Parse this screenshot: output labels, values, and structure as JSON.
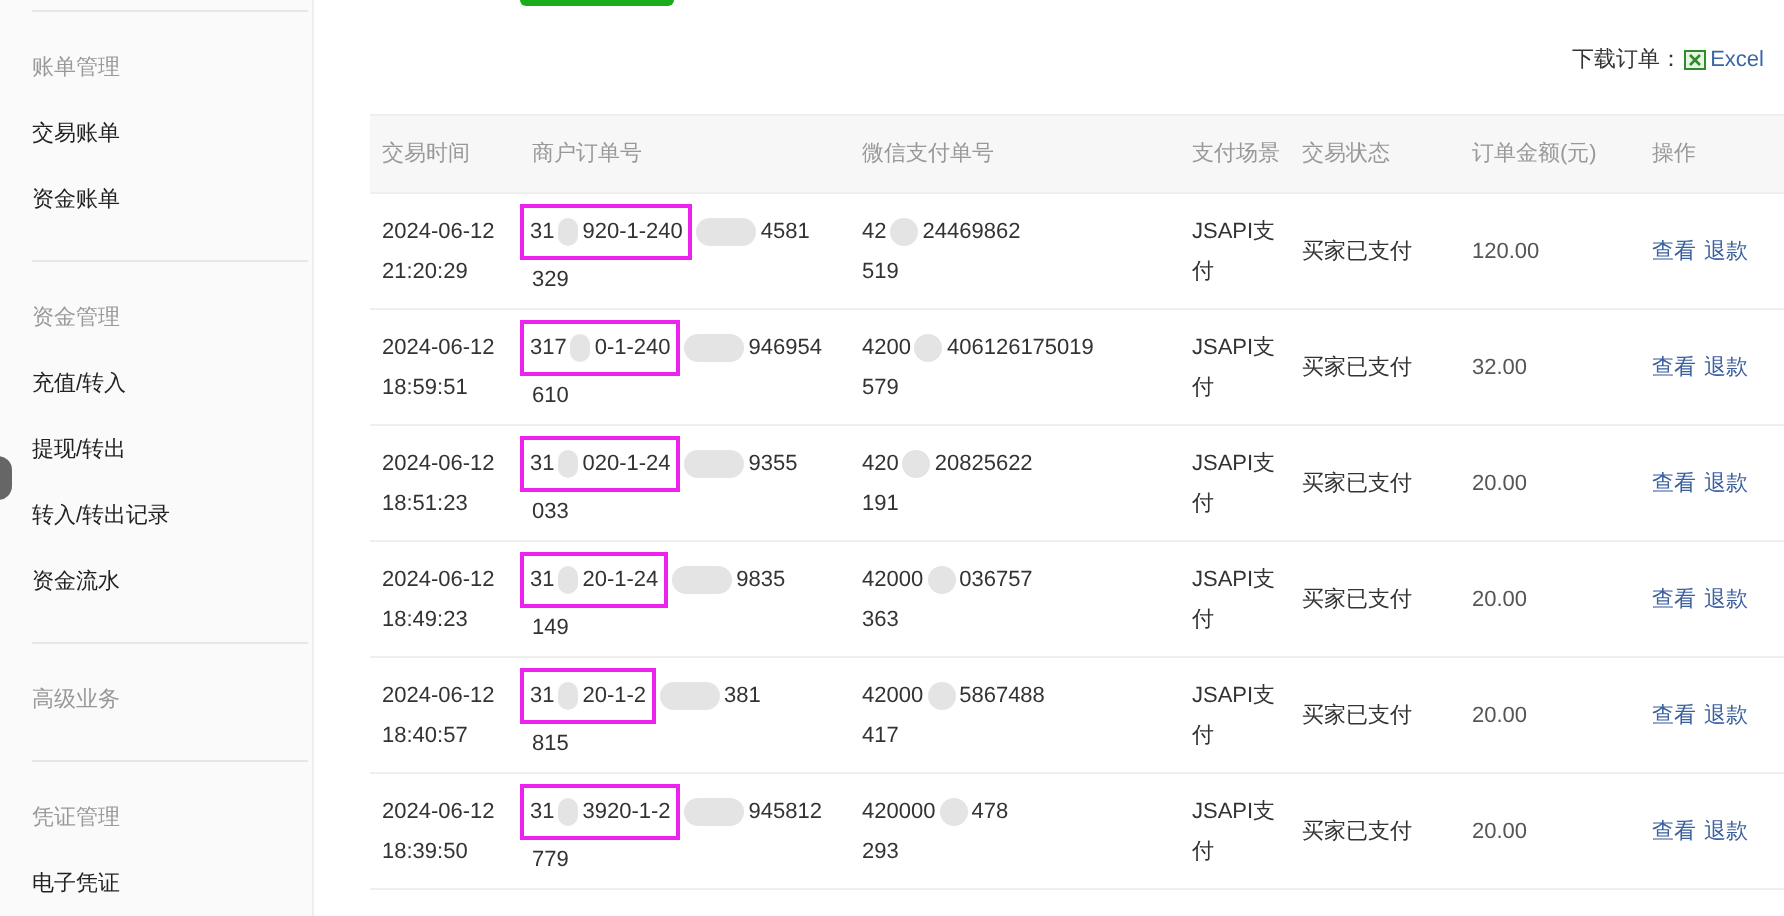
{
  "sidebar": {
    "sections": [
      {
        "title": "账单管理",
        "items": [
          "交易账单",
          "资金账单"
        ]
      },
      {
        "title": "资金管理",
        "items": [
          "充值/转入",
          "提现/转出",
          "转入/转出记录",
          "资金流水"
        ]
      },
      {
        "title": "高级业务"
      },
      {
        "title": "凭证管理",
        "items": [
          "电子凭证"
        ]
      }
    ]
  },
  "download": {
    "label": "下载订单：",
    "link": "Excel"
  },
  "table": {
    "columns": [
      "交易时间",
      "商户订单号",
      "微信支付单号",
      "支付场景",
      "交易状态",
      "订单金额(元)",
      "操作"
    ],
    "rows": [
      {
        "date": "2024-06-12",
        "time": "21:20:29",
        "merchant_parts": [
          "31",
          "920-1-240",
          "4581"
        ],
        "merchant_line2": "329",
        "wechat_parts": [
          "42",
          "24469862"
        ],
        "wechat_line2": "519",
        "scene": "JSAPI支付",
        "status": "买家已支付",
        "amount": "120.00",
        "actions": [
          "查看",
          "退款"
        ]
      },
      {
        "date": "2024-06-12",
        "time": "18:59:51",
        "merchant_parts": [
          "317",
          "0-1-240",
          "946954"
        ],
        "merchant_line2": "610",
        "wechat_parts": [
          "4200",
          "406126175019"
        ],
        "wechat_line2": "579",
        "scene": "JSAPI支付",
        "status": "买家已支付",
        "amount": "32.00",
        "actions": [
          "查看",
          "退款"
        ]
      },
      {
        "date": "2024-06-12",
        "time": "18:51:23",
        "merchant_parts": [
          "31",
          "020-1-24",
          "9355"
        ],
        "merchant_line2": "033",
        "wechat_parts": [
          "420",
          "20825622"
        ],
        "wechat_line2": "191",
        "scene": "JSAPI支付",
        "status": "买家已支付",
        "amount": "20.00",
        "actions": [
          "查看",
          "退款"
        ]
      },
      {
        "date": "2024-06-12",
        "time": "18:49:23",
        "merchant_parts": [
          "31",
          "20-1-24",
          "9835"
        ],
        "merchant_line2": "149",
        "wechat_parts": [
          "42000",
          "036757"
        ],
        "wechat_line2": "363",
        "scene": "JSAPI支付",
        "status": "买家已支付",
        "amount": "20.00",
        "actions": [
          "查看",
          "退款"
        ]
      },
      {
        "date": "2024-06-12",
        "time": "18:40:57",
        "merchant_parts": [
          "31",
          "20-1-2",
          "381"
        ],
        "merchant_line2": "815",
        "wechat_parts": [
          "42000",
          "5867488"
        ],
        "wechat_line2": "417",
        "scene": "JSAPI支付",
        "status": "买家已支付",
        "amount": "20.00",
        "actions": [
          "查看",
          "退款"
        ]
      },
      {
        "date": "2024-06-12",
        "time": "18:39:50",
        "merchant_parts": [
          "31",
          "3920-1-2",
          "945812"
        ],
        "merchant_line2": "779",
        "wechat_parts": [
          "420000",
          "478"
        ],
        "wechat_line2": "293",
        "scene": "JSAPI支付",
        "status": "买家已支付",
        "amount": "20.00",
        "actions": [
          "查看",
          "退款"
        ]
      }
    ]
  }
}
